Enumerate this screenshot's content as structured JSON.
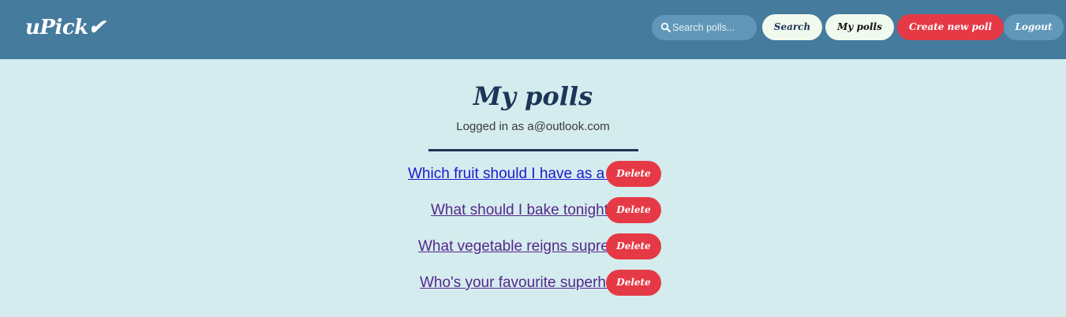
{
  "brand": {
    "logo_text": "uPick✔"
  },
  "nav": {
    "search_placeholder": "Search polls...",
    "search_value": "",
    "search_label": "Search",
    "my_polls_label": "My polls",
    "create_label": "Create new poll",
    "logout_label": "Logout"
  },
  "main": {
    "title": "My polls",
    "logged_in_text": "Logged in as a@outlook.com",
    "delete_label": "Delete",
    "polls": [
      {
        "title": "Which fruit should I have as a snack?",
        "link_state": "unvisited"
      },
      {
        "title": "What should I bake tonight?",
        "link_state": "visited"
      },
      {
        "title": "What vegetable reigns supreme?",
        "link_state": "visited"
      },
      {
        "title": "Who's your favourite superhero?",
        "link_state": "visited"
      }
    ]
  },
  "colors": {
    "navbar": "#457b9d",
    "background": "#d4ecee",
    "accent_red": "#e63946",
    "dark_navy": "#1d3557",
    "light_button": "#f1faee",
    "search_field": "#6198b9"
  },
  "icons": {
    "search": "magnifier-icon"
  }
}
